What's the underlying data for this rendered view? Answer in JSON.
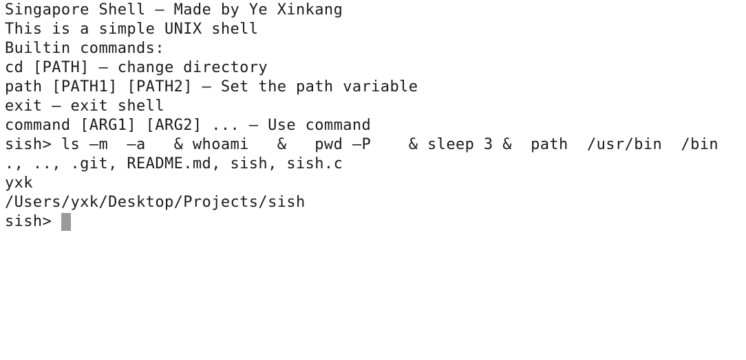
{
  "terminal": {
    "lines": [
      "Singapore Shell – Made by Ye Xinkang",
      "This is a simple UNIX shell",
      "Builtin commands:",
      "cd [PATH] – change directory",
      "path [PATH1] [PATH2] – Set the path variable",
      "exit – exit shell",
      "command [ARG1] [ARG2] ... – Use command",
      "sish> ls –m  –a   & whoami   &   pwd –P    & sleep 3 &  path  /usr/bin  /bin",
      "., .., .git, README.md, sish, sish.c",
      "yxk",
      "/Users/yxk/Desktop/Projects/sish"
    ],
    "prompt": "sish>",
    "cursor_color": "#9a9a9a"
  }
}
